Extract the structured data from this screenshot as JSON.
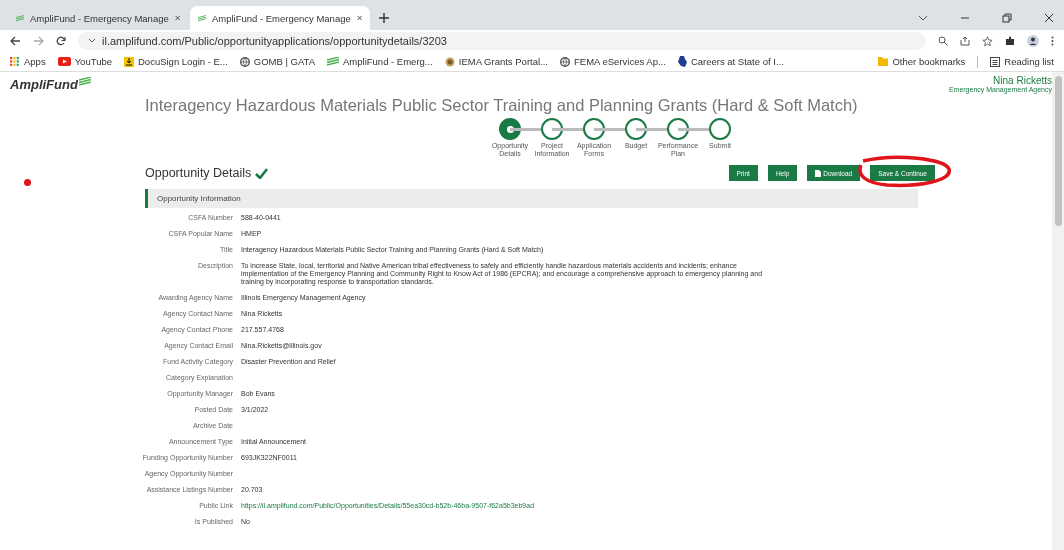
{
  "browser": {
    "tabs": [
      {
        "title": "AmpliFund - Emergency Manage",
        "selected": false
      },
      {
        "title": "AmpliFund - Emergency Manage",
        "selected": true
      }
    ],
    "url": "il.amplifund.com/Public/opportunityapplications/opportunitydetails/3203",
    "bookmarks": [
      {
        "label": "Apps",
        "kind": "apps"
      },
      {
        "label": "YouTube",
        "kind": "youtube"
      },
      {
        "label": "DocuSign Login - E...",
        "kind": "download"
      },
      {
        "label": "GOMB | GATA",
        "kind": "globe"
      },
      {
        "label": "AmpliFund - Emerg...",
        "kind": "amplifund"
      },
      {
        "label": "IEMA Grants Portal...",
        "kind": "seal"
      },
      {
        "label": "FEMA eServices Ap...",
        "kind": "globe"
      },
      {
        "label": "Careers at State of I...",
        "kind": "state"
      }
    ],
    "other_bookmarks": "Other bookmarks",
    "reading_list": "Reading list"
  },
  "header": {
    "logo": "AmpliFund",
    "user": "Nina Ricketts",
    "agency": "Emergency Management Agency"
  },
  "page_title": "Interagency Hazardous Materials Public Sector Training and Planning Grants (Hard & Soft Match)",
  "steps": [
    {
      "label": "Opportunity Details",
      "selected": true
    },
    {
      "label": "Project Information",
      "selected": false
    },
    {
      "label": "Application Forms",
      "selected": false
    },
    {
      "label": "Budget",
      "selected": false
    },
    {
      "label": "Performance Plan",
      "selected": false
    },
    {
      "label": "Submit",
      "selected": false
    }
  ],
  "section": {
    "title": "Opportunity Details",
    "complete": true,
    "buttons": [
      {
        "label": "Print",
        "kind": "plain"
      },
      {
        "label": "Help",
        "kind": "plain"
      },
      {
        "label": "Download",
        "kind": "download"
      },
      {
        "label": "Save & Continue",
        "kind": "plain"
      }
    ],
    "panel_title": "Opportunity Information"
  },
  "fields": [
    {
      "label": "CSFA Number",
      "value": "588-40-0441"
    },
    {
      "label": "CSFA Popular Name",
      "value": "HMEP"
    },
    {
      "label": "Title",
      "value": "Interagency Hazardous Materials Public Sector Training and Planning Grants (Hard & Soft Match)"
    },
    {
      "label": "Description",
      "value": "To increase State, local, territorial and Native American tribal effectiveness to safely and efficiently handle hazardous materials accidents and incidents; enhance implementation of the Emergency Planning and Community Right to Know Act of 1986 (EPCRA); and encourage a comprehensive approach to emergency planning and training by incorporating response to transportation standards."
    },
    {
      "label": "Awarding Agency Name",
      "value": "Illinois Emergency Management Agency"
    },
    {
      "label": "Agency Contact Name",
      "value": "Nina Ricketts"
    },
    {
      "label": "Agency Contact Phone",
      "value": "217.557.4768"
    },
    {
      "label": "Agency Contact Email",
      "value": "Nina.Ricketts@illinois.gov"
    },
    {
      "label": "Fund Activity Category",
      "value": "Disaster Prevention and Relief"
    },
    {
      "label": "Category Explanation"
    },
    {
      "label": "Opportunity Manager",
      "value": "Bob Evans"
    },
    {
      "label": "Posted Date",
      "value": "3/1/2022"
    },
    {
      "label": "Archive Date"
    },
    {
      "label": "Announcement Type",
      "value": "Initial Announcement"
    },
    {
      "label": "Funding Opportunity Number",
      "value": "693JK322NF0011"
    },
    {
      "label": "Agency Opportunity Number"
    },
    {
      "label": "Assistance Listings Number",
      "value": "20.703"
    },
    {
      "label": "Public Link",
      "value": "https://il.amplifund.com/Public/Opportunities/Details/55ea30cd-b52b-46ba-9507-f62a5b3eb9ad",
      "kind": "link"
    },
    {
      "label": "Is Published",
      "value": "No"
    }
  ]
}
